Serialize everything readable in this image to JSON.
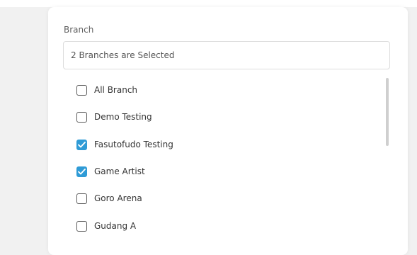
{
  "branch_field": {
    "label": "Branch",
    "selected_summary": "2 Branches are Selected"
  },
  "options": [
    {
      "label": "All Branch",
      "checked": false
    },
    {
      "label": "Demo Testing",
      "checked": false
    },
    {
      "label": "Fasutofudo Testing",
      "checked": true
    },
    {
      "label": "Game Artist",
      "checked": true
    },
    {
      "label": "Goro Arena",
      "checked": false
    },
    {
      "label": "Gudang A",
      "checked": false
    }
  ],
  "colors": {
    "checked": "#2f9bd6",
    "unchecked_border": "#5a5a5a"
  }
}
